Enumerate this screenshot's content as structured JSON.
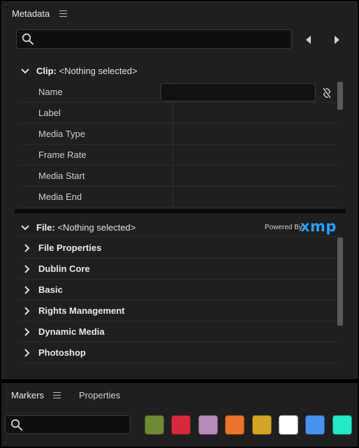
{
  "metadata_panel": {
    "title": "Metadata",
    "search_placeholder": "",
    "clip_section": {
      "label": "Clip:",
      "value": "<Nothing selected>",
      "fields": [
        {
          "label": "Name"
        },
        {
          "label": "Label"
        },
        {
          "label": "Media Type"
        },
        {
          "label": "Frame Rate"
        },
        {
          "label": "Media Start"
        },
        {
          "label": "Media End"
        }
      ],
      "name_value": ""
    },
    "file_section": {
      "label": "File:",
      "value": "<Nothing selected>",
      "powered_by": "Powered By",
      "xmp_logo": "xmp",
      "groups": [
        {
          "label": "File Properties"
        },
        {
          "label": "Dublin Core"
        },
        {
          "label": "Basic"
        },
        {
          "label": "Rights Management"
        },
        {
          "label": "Dynamic Media"
        },
        {
          "label": "Photoshop"
        }
      ]
    }
  },
  "markers_panel": {
    "tab_markers": "Markers",
    "tab_properties": "Properties",
    "search_placeholder": "",
    "color_swatches": [
      "#6e8a35",
      "#d62a3a",
      "#b68cb8",
      "#e8752a",
      "#d5a527",
      "#ffffff",
      "#4a90f0",
      "#25e8c6"
    ]
  },
  "colors": {
    "xmp_blue": "#2b9ff5",
    "panel_bg": "#1f1f1f"
  }
}
